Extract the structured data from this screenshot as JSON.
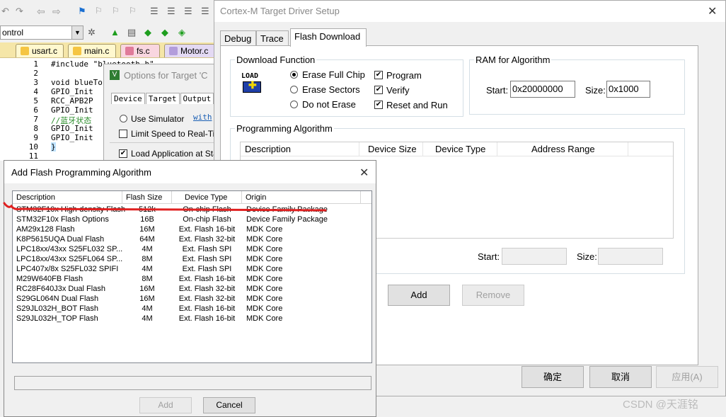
{
  "ide": {
    "combo_text": "ontrol",
    "file_tabs": [
      {
        "label": "usart.c",
        "color": "#f5c542"
      },
      {
        "label": "main.c",
        "color": "#f5c542"
      },
      {
        "label": "fs.c",
        "color": "#e07b9a"
      },
      {
        "label": "Motor.c",
        "color": "#b39ddb"
      }
    ],
    "line_numbers": [
      "1",
      "2",
      "3",
      "4",
      "5",
      "6",
      "7",
      "8",
      "9",
      "10",
      "11"
    ],
    "code_lines": [
      "#include \"bluetooth.h\"",
      "",
      "void blueTo",
      "  GPIO_Init",
      "  RCC_APB2P",
      "  GPIO_Init",
      "  //蓝牙状态",
      "  GPIO_Init",
      "  GPIO_Init",
      "}",
      ""
    ],
    "options_dialog": {
      "title": "Options for Target 'C",
      "tabs": [
        "Device",
        "Target",
        "Output"
      ],
      "use_simulator": "Use Simulator",
      "with_link": "with",
      "limit_speed": "Limit Speed to Real-Time",
      "load_app": "Load Application at Start"
    }
  },
  "cortex": {
    "title": "Cortex-M Target Driver Setup",
    "tabs": [
      "Debug",
      "Trace",
      "Flash Download"
    ],
    "active_tab": "Flash Download",
    "download_function": {
      "label": "Download Function",
      "load_icon_text": "LOAD",
      "radios": [
        {
          "label": "Erase Full Chip",
          "checked": true
        },
        {
          "label": "Erase Sectors",
          "checked": false
        },
        {
          "label": "Do not Erase",
          "checked": false
        }
      ],
      "checks": [
        {
          "label": "Program",
          "checked": true
        },
        {
          "label": "Verify",
          "checked": true
        },
        {
          "label": "Reset and Run",
          "checked": true
        }
      ]
    },
    "ram": {
      "label": "RAM for Algorithm",
      "start_label": "Start:",
      "start_value": "0x20000000",
      "size_label": "Size:",
      "size_value": "0x1000"
    },
    "programming": {
      "label": "Programming Algorithm",
      "columns": [
        "Description",
        "Device Size",
        "Device Type",
        "Address Range"
      ],
      "start_label": "Start:",
      "size_label": "Size:"
    },
    "add_label": "Add",
    "remove_label": "Remove",
    "ok_label": "确定",
    "cancel_label": "取消",
    "apply_label": "应用(A)"
  },
  "addflash": {
    "title": "Add Flash Programming Algorithm",
    "columns": [
      "Description",
      "Flash Size",
      "Device Type",
      "Origin"
    ],
    "rows": [
      [
        "STM32F10x High-density Flash",
        "512k",
        "On-chip Flash",
        "Device Family Package"
      ],
      [
        "STM32F10x Flash Options",
        "16B",
        "On-chip Flash",
        "Device Family Package"
      ],
      [
        "AM29x128 Flash",
        "16M",
        "Ext. Flash 16-bit",
        "MDK Core"
      ],
      [
        "K8P5615UQA Dual Flash",
        "64M",
        "Ext. Flash 32-bit",
        "MDK Core"
      ],
      [
        "LPC18xx/43xx S25FL032 SP...",
        "4M",
        "Ext. Flash SPI",
        "MDK Core"
      ],
      [
        "LPC18xx/43xx S25FL064 SP...",
        "8M",
        "Ext. Flash SPI",
        "MDK Core"
      ],
      [
        "LPC407x/8x S25FL032 SPIFI",
        "4M",
        "Ext. Flash SPI",
        "MDK Core"
      ],
      [
        "M29W640FB Flash",
        "8M",
        "Ext. Flash 16-bit",
        "MDK Core"
      ],
      [
        "RC28F640J3x Dual Flash",
        "16M",
        "Ext. Flash 32-bit",
        "MDK Core"
      ],
      [
        "S29GL064N Dual Flash",
        "16M",
        "Ext. Flash 32-bit",
        "MDK Core"
      ],
      [
        "S29JL032H_BOT Flash",
        "4M",
        "Ext. Flash 16-bit",
        "MDK Core"
      ],
      [
        "S29JL032H_TOP Flash",
        "4M",
        "Ext. Flash 16-bit",
        "MDK Core"
      ]
    ],
    "add_label": "Add",
    "cancel_label": "Cancel"
  },
  "watermark": "CSDN @天涯铭",
  "annotation_color": "#e02020"
}
